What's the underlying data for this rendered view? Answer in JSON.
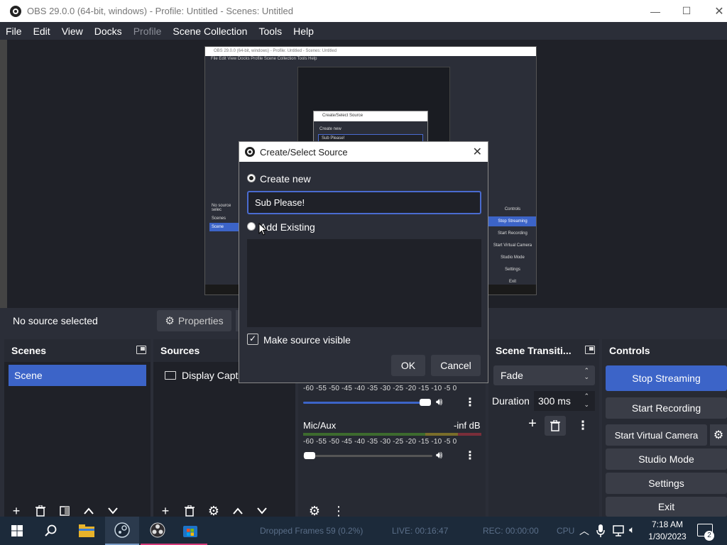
{
  "window": {
    "title": "OBS 29.0.0 (64-bit, windows) - Profile: Untitled - Scenes: Untitled"
  },
  "menu": {
    "file": "File",
    "edit": "Edit",
    "view": "View",
    "docks": "Docks",
    "profile": "Profile",
    "scene_collection": "Scene Collection",
    "tools": "Tools",
    "help": "Help"
  },
  "preview": {
    "title": "OBS 29.0.0 (64-bit, windows) - Profile: Untitled - Scenes: Untitled",
    "menu": "File  Edit  View  Docks  Profile  Scene Collection  Tools  Help",
    "dialog_title": "Create/Select Source",
    "create_new": "Create new",
    "field": "Sub Please!",
    "no_source": "No source selec",
    "scenes": "Scenes",
    "scene": "Scene",
    "controls": "Controls",
    "stop_streaming": "Stop Streaming",
    "start_recording": "Start Recording",
    "start_virtual_camera": "Start Virtual Camera",
    "studio_mode": "Studio Mode",
    "settings": "Settings",
    "exit": "Exit"
  },
  "source_bar": {
    "no_source": "No source selected",
    "properties": "Properties"
  },
  "scenes_dock": {
    "title": "Scenes",
    "items": [
      "Scene"
    ]
  },
  "sources_dock": {
    "title": "Sources",
    "items": [
      "Display Captu"
    ]
  },
  "mixer": {
    "scale": "-60 -55 -50 -45 -40 -35 -30 -25 -20 -15 -10 -5 0",
    "channels": [
      {
        "name": "Mic/Aux",
        "level": "-inf dB"
      }
    ]
  },
  "transitions_dock": {
    "title": "Scene Transiti...",
    "selected": "Fade",
    "duration_label": "Duration",
    "duration_value": "300 ms"
  },
  "controls_dock": {
    "title": "Controls",
    "stop_streaming": "Stop Streaming",
    "start_recording": "Start Recording",
    "start_virtual_camera": "Start Virtual Camera",
    "studio_mode": "Studio Mode",
    "settings": "Settings",
    "exit": "Exit"
  },
  "dialog": {
    "title": "Create/Select Source",
    "create_new": "Create new",
    "name_value": "Sub Please!",
    "add_existing": "Add Existing",
    "make_visible": "Make source visible",
    "ok": "OK",
    "cancel": "Cancel"
  },
  "statusbar": {
    "dropped_frames": "Dropped Frames 59 (0.2%)",
    "live": "LIVE: 00:16:47",
    "rec": "REC: 00:00:00",
    "cpu": "CPU"
  },
  "taskbar": {
    "time": "7:18 AM",
    "date": "1/30/2023",
    "notification_count": "2"
  },
  "colors": {
    "accent": "#3c64c8",
    "panel": "#272a33",
    "background": "#1f2128"
  }
}
